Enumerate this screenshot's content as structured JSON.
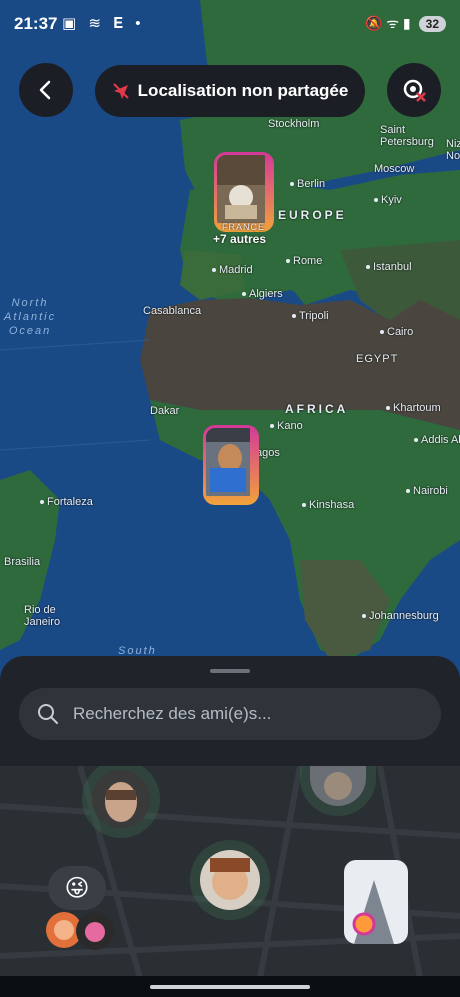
{
  "status_bar": {
    "time": "21:37",
    "left_icons": "▣ ≋ 𝐄 •",
    "right_icons": "🔕 ᯤ ▮",
    "battery": "32"
  },
  "header": {
    "back_icon": "chevron-left-icon",
    "location_status": "Localisation non partagée",
    "location_off_icon": "location-off-icon",
    "settings_icon": "settings-off-icon"
  },
  "map": {
    "labels": {
      "stockholm": "Stockholm",
      "saint_petersburg": "Saint\nPetersburg",
      "nizhny": "Niz\nNov",
      "moscow": "Moscow",
      "berlin": "Berlin",
      "europe": "EUROPE",
      "kyiv": "Kyiv",
      "madrid": "Madrid",
      "rome": "Rome",
      "istanbul": "Istanbul",
      "algiers": "Algiers",
      "casablanca": "Casablanca",
      "tripoli": "Tripoli",
      "cairo": "Cairo",
      "egypt": "EGYPT",
      "north_atlantic": "North\nAtlantic\nOcean",
      "dakar": "Dakar",
      "africa": "AFRICA",
      "khartoum": "Khartoum",
      "kano": "Kano",
      "lagos": "agos",
      "addis": "Addis Ab",
      "fortaleza": "Fortaleza",
      "kinshasa": "Kinshasa",
      "nairobi": "Nairobi",
      "brasilia": "Brasilia",
      "rio": "Rio de\nJaneiro",
      "johannesburg": "Johannesburg",
      "south": "South",
      "france": "FRANCE"
    },
    "marker_europe_more": "+7 autres"
  },
  "sheet": {
    "search_placeholder": "Recherchez des ami(e)s...",
    "search_icon": "search-icon",
    "emoji_status": "😜"
  },
  "colors": {
    "ocean": "#1a4a86",
    "land_green": "#2f6a3c",
    "land_desert": "#4a463f",
    "marker_gradient_start": "#d4389b",
    "marker_gradient_end": "#f1a33a",
    "sheet_bg": "#20242a"
  }
}
